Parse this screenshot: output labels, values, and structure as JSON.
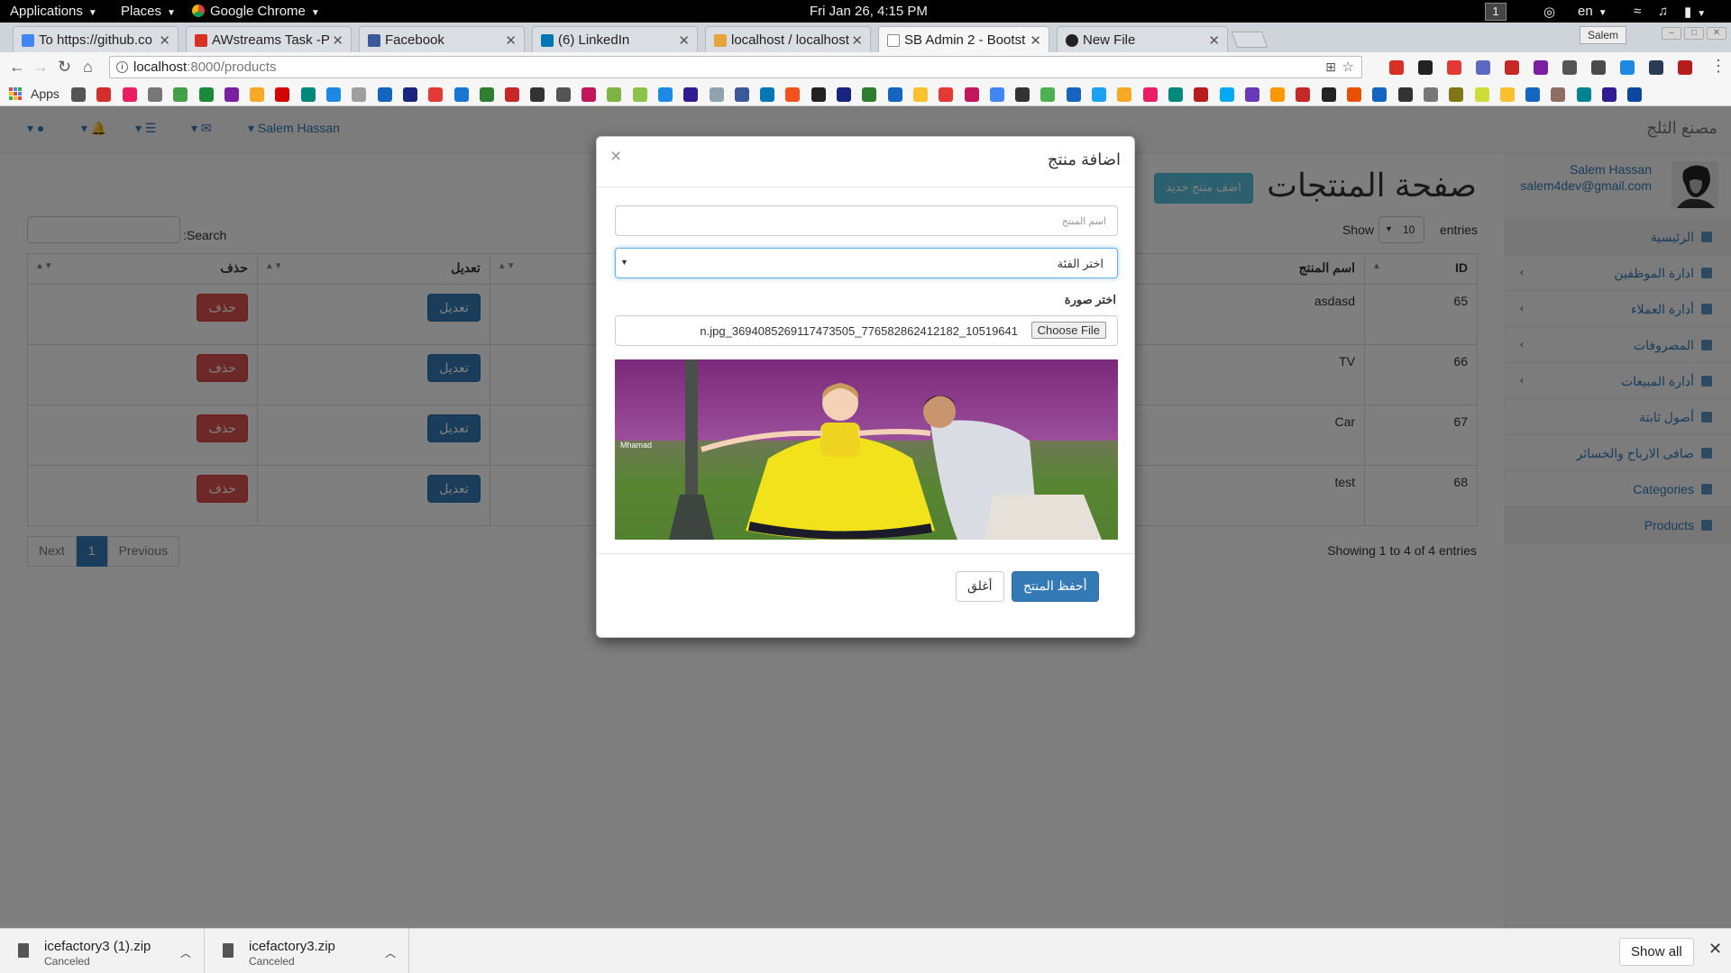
{
  "system_bar": {
    "applications": "Applications",
    "places": "Places",
    "chrome": "Google Chrome",
    "datetime": "Fri Jan 26,  4:15 PM",
    "workspace": "1",
    "lang": "en"
  },
  "tabs": [
    {
      "title": "To https://github.co",
      "color": "#4285f4"
    },
    {
      "title": "AWstreams Task -P",
      "color": "#d93025"
    },
    {
      "title": "Facebook",
      "color": "#3b5998"
    },
    {
      "title": "(6) LinkedIn",
      "color": "#0077b5"
    },
    {
      "title": "localhost / localhost",
      "color": "#e8a33d"
    },
    {
      "title": "SB Admin 2 - Bootst",
      "color": "#888888"
    },
    {
      "title": "New File",
      "color": "#222222"
    }
  ],
  "profile": "Salem",
  "address": {
    "host": "localhost",
    "path": ":8000/products"
  },
  "bookmarks": {
    "apps_label": "Apps"
  },
  "app": {
    "brand": "مصنع الثلج",
    "user_menu": "Salem Hassan",
    "user": {
      "name": "Salem Hassan",
      "email": "salem4dev@gmail.com"
    },
    "sidebar": [
      {
        "label": "الرئيسية",
        "chevron": false
      },
      {
        "label": "ادارة الموظفين",
        "chevron": true
      },
      {
        "label": "أدارة العملاء",
        "chevron": true
      },
      {
        "label": "المصروفات",
        "chevron": true
      },
      {
        "label": "أدارة المبيعات",
        "chevron": true
      },
      {
        "label": "أصول ثابتة",
        "chevron": false
      },
      {
        "label": "صافى الارباح والخسائر",
        "chevron": false
      },
      {
        "label": "Categories",
        "chevron": false
      },
      {
        "label": "Products",
        "chevron": false
      }
    ],
    "page_title": "صفحة المنتجات",
    "add_button": "اضف منتج جديد",
    "search_label": ":Search",
    "show_label": "Show",
    "page_length": "10",
    "entries_label": "entries",
    "table": {
      "headers": {
        "id": "ID",
        "name": "اسم المنتج",
        "edit": "تعديل",
        "delete": "حذف"
      },
      "rows": [
        {
          "id": "65",
          "name": "asdasd",
          "edit": "تعديل",
          "delete": "حذف"
        },
        {
          "id": "66",
          "name": "TV",
          "edit": "تعديل",
          "delete": "حذف"
        },
        {
          "id": "67",
          "name": "Car",
          "edit": "تعديل",
          "delete": "حذف"
        },
        {
          "id": "68",
          "name": "test",
          "edit": "تعديل",
          "delete": "حذف"
        }
      ]
    },
    "pagination": {
      "next": "Next",
      "current": "1",
      "previous": "Previous"
    },
    "info": "Showing 1 to 4 of 4 entries"
  },
  "modal": {
    "title": "اضافة منتج",
    "close": "×",
    "name_placeholder": "اسم المنتج",
    "category_select": "اختر الفئة",
    "image_label": "اختر صورة",
    "file_name": "n.jpg_36940852691174735​05_7765828624121​82_10519641",
    "choose_file": "Choose File",
    "preview_caption": "Mhamad",
    "save": "أحفظ المنتج",
    "cancel": "أغلق"
  },
  "downloads": [
    {
      "name": "icefactory3 (1).zip",
      "status": "Canceled"
    },
    {
      "name": "icefactory3.zip",
      "status": "Canceled"
    }
  ],
  "show_all": "Show all",
  "colors": {
    "primary": "#337ab7",
    "danger": "#d9534f",
    "info": "#5bc0de"
  }
}
